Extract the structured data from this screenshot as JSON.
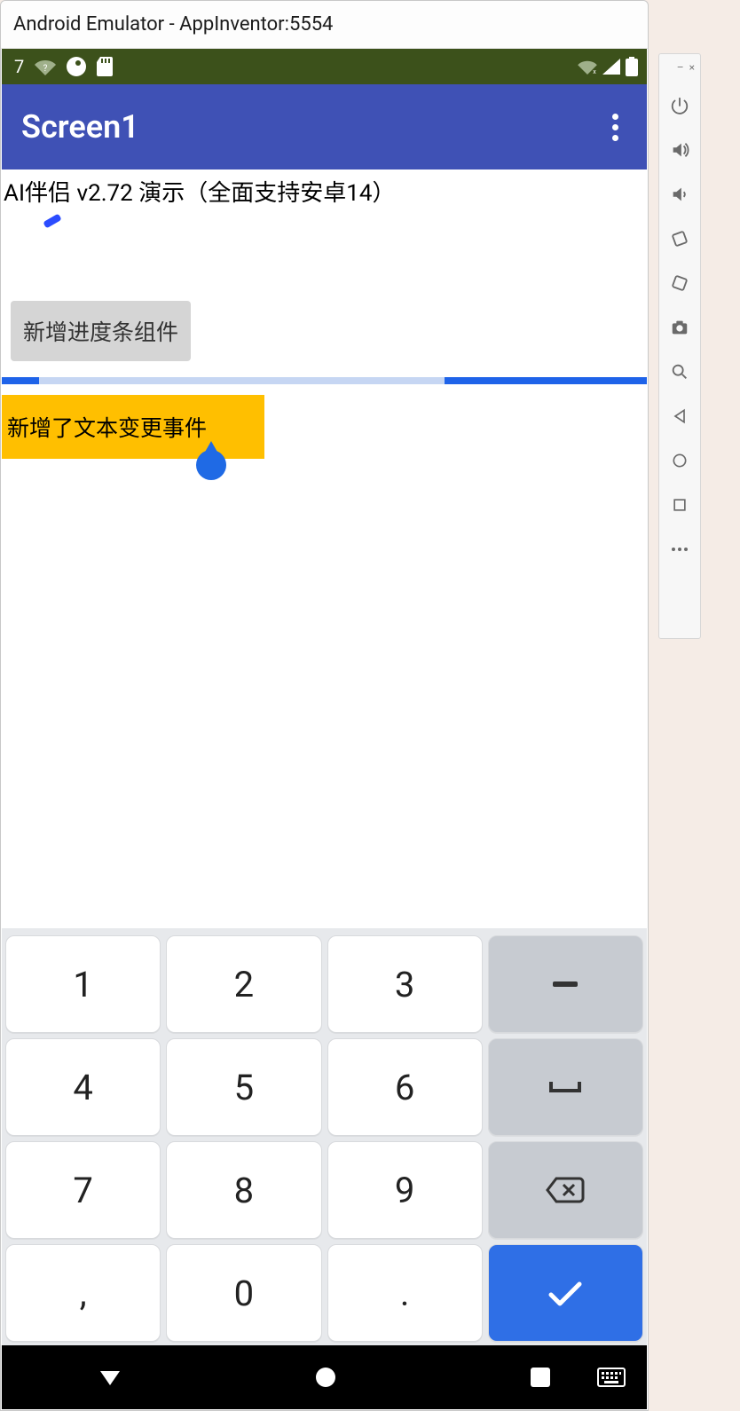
{
  "window": {
    "title": "Android Emulator - AppInventor:5554"
  },
  "statusbar": {
    "time": "7"
  },
  "appbar": {
    "title": "Screen1"
  },
  "content": {
    "version_line": "AI伴侣 v2.72 演示（全面支持安卓14）",
    "button_label": "新增进度条组件",
    "textfield_value": "新增了文本变更事件"
  },
  "keypad": {
    "rows": [
      [
        "1",
        "2",
        "3",
        "-"
      ],
      [
        "4",
        "5",
        "6",
        "␣"
      ],
      [
        "7",
        "8",
        "9",
        "⌫"
      ],
      [
        ",",
        "0",
        ".",
        "✓"
      ]
    ]
  },
  "side_toolbar": {
    "minimize": "–",
    "close": "×"
  }
}
